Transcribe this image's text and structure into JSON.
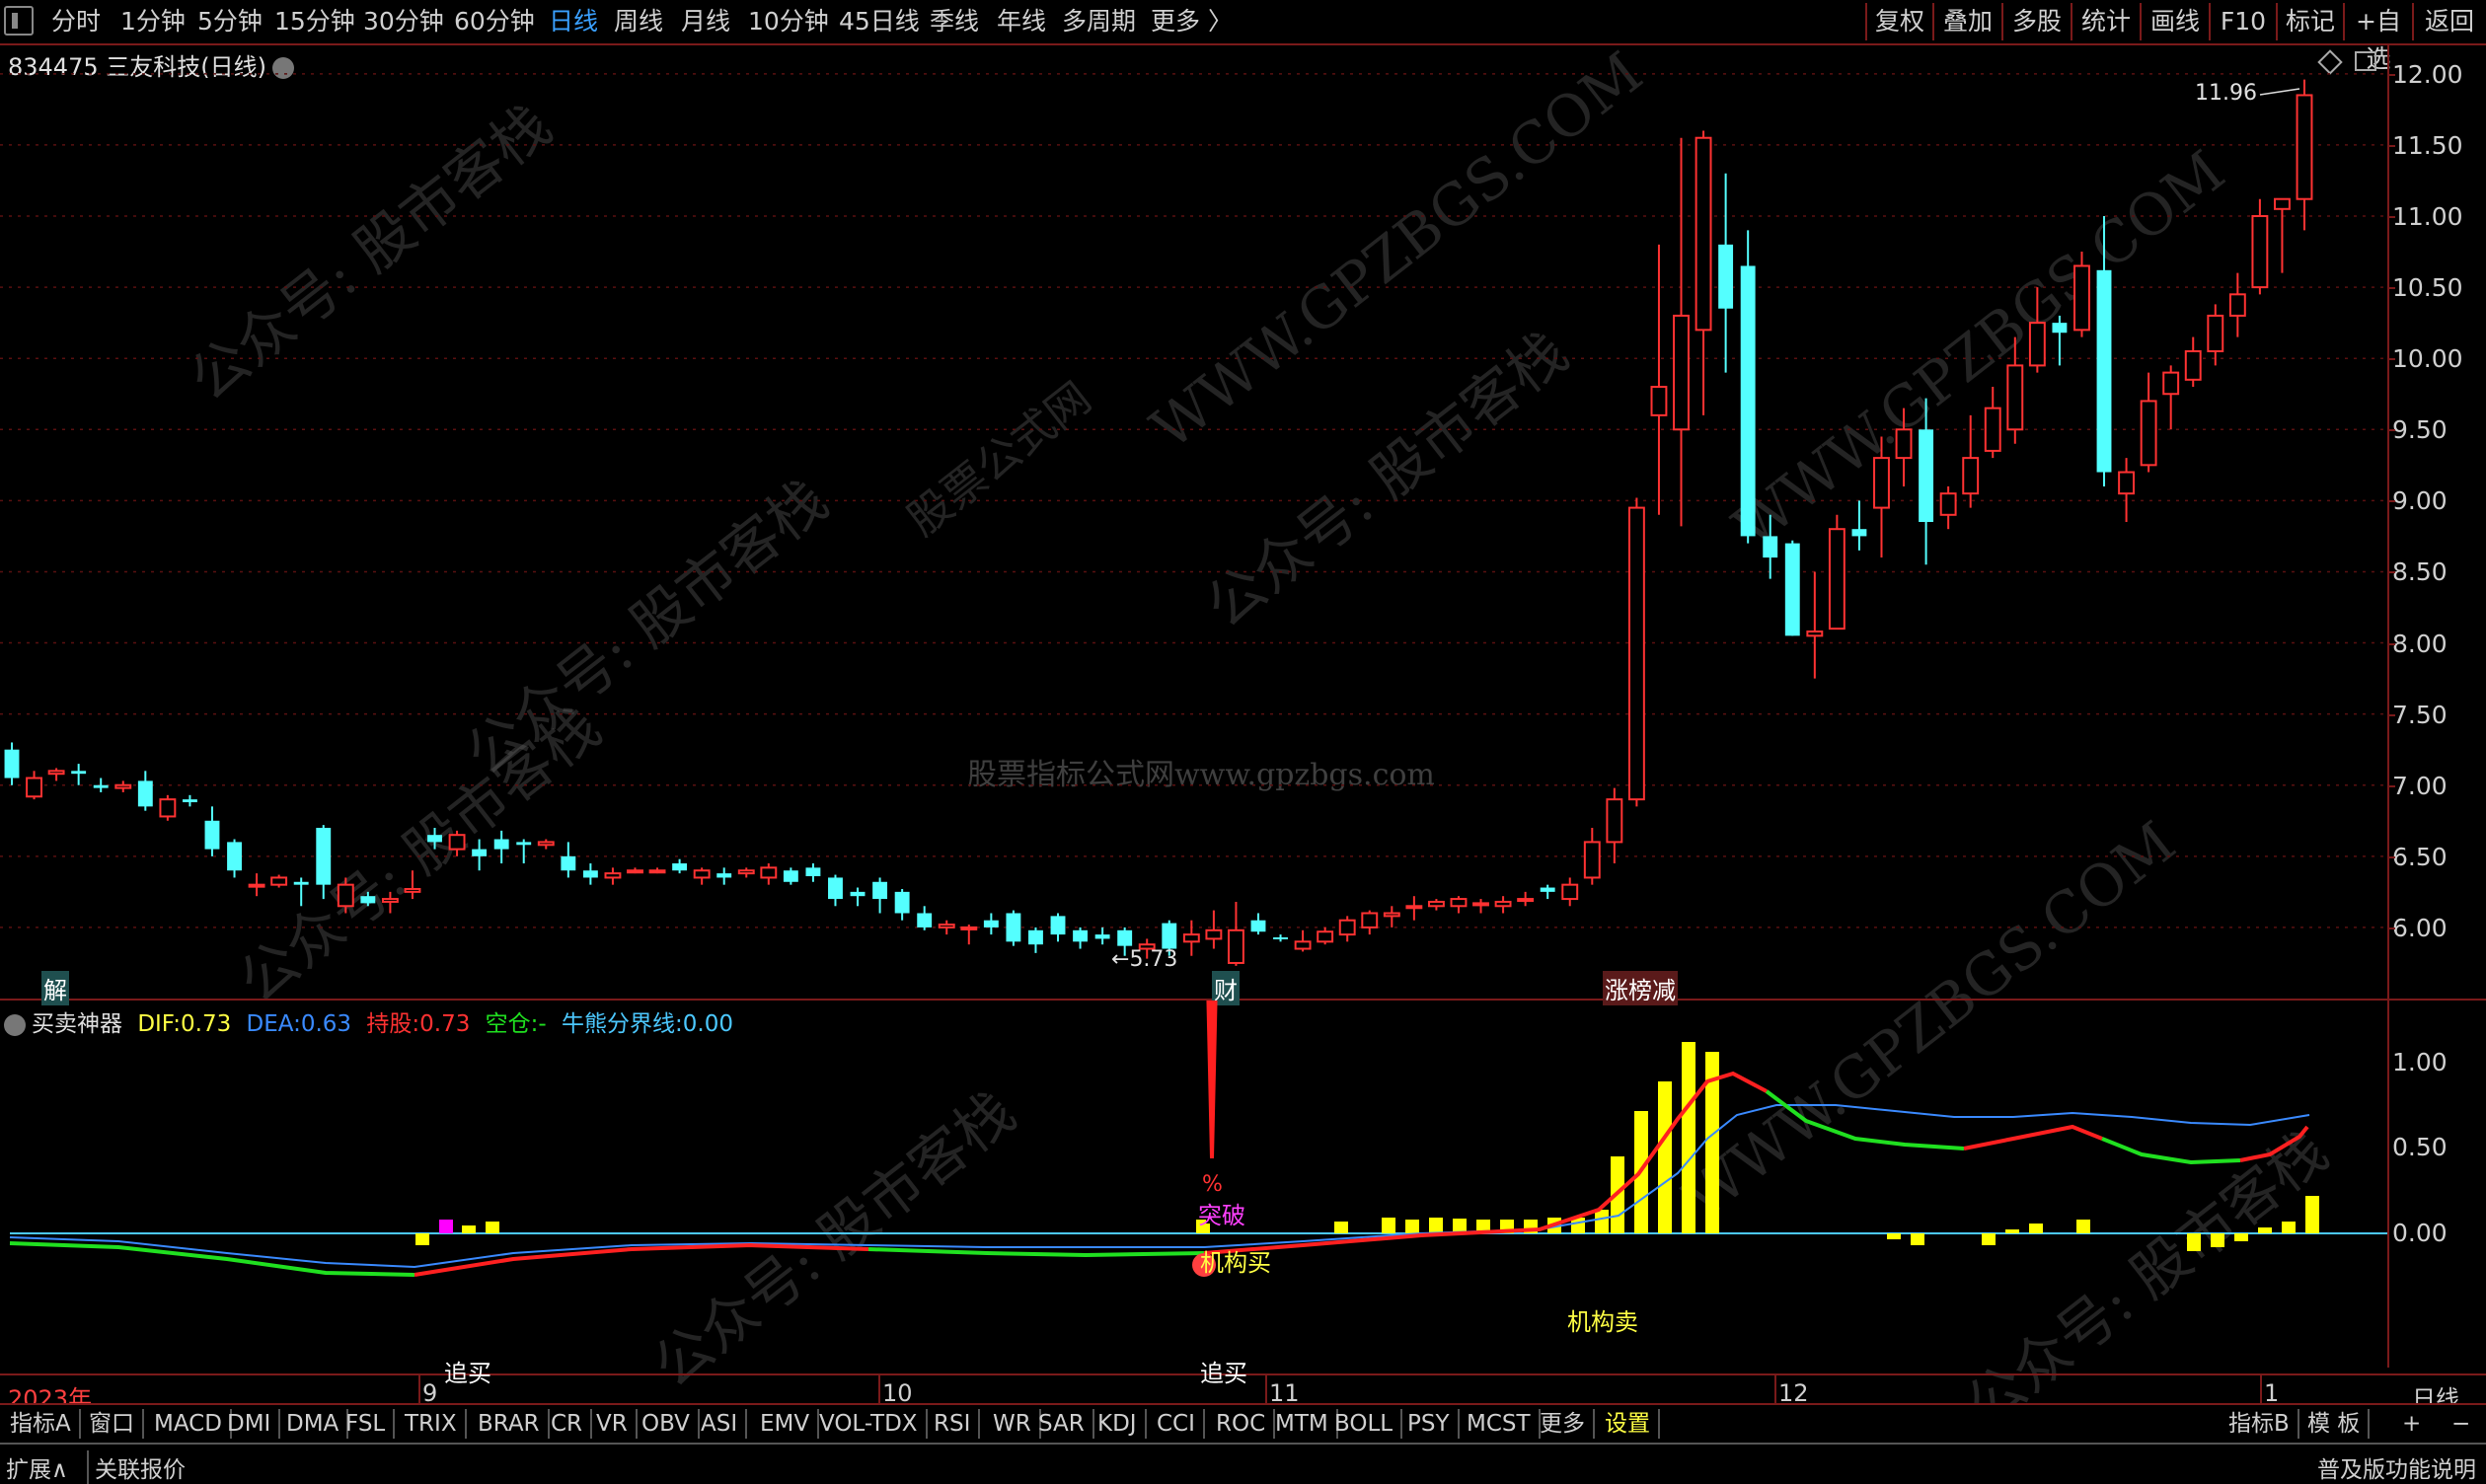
{
  "toolbar": {
    "periods": [
      {
        "label": "分时",
        "active": false
      },
      {
        "label": "1分钟",
        "active": false
      },
      {
        "label": "5分钟",
        "active": false
      },
      {
        "label": "15分钟",
        "active": false
      },
      {
        "label": "30分钟",
        "active": false
      },
      {
        "label": "60分钟",
        "active": false
      },
      {
        "label": "日线",
        "active": true
      },
      {
        "label": "周线",
        "active": false
      },
      {
        "label": "月线",
        "active": false
      },
      {
        "label": "10分钟",
        "active": false
      },
      {
        "label": "45日线",
        "active": false
      },
      {
        "label": "季线",
        "active": false
      },
      {
        "label": "年线",
        "active": false
      },
      {
        "label": "多周期",
        "active": false
      },
      {
        "label": "更多 〉",
        "active": false
      }
    ],
    "right_buttons": [
      "复权",
      "叠加",
      "多股",
      "统计",
      "画线",
      "F10",
      "标记",
      "+自选",
      "返回"
    ]
  },
  "stock_title": "834475 三友科技(日线)",
  "price_axis": [
    "12.00",
    "11.50",
    "11.00",
    "10.50",
    "10.00",
    "9.50",
    "9.00",
    "8.50",
    "8.00",
    "7.50",
    "7.00",
    "6.50",
    "6.00"
  ],
  "annotations": {
    "max_price": "11.96",
    "min_price": "5.73",
    "jie": "解",
    "cai": "财",
    "zhangbang": "涨榜减",
    "zhuimai1": "追买",
    "zhuimai2": "追买",
    "tupo": "突破",
    "pct": "%",
    "jigoumai": "机构买",
    "jigoumai2": "机构卖"
  },
  "indicator": {
    "name": "买卖神器",
    "dif_label": "DIF:",
    "dif": "0.73",
    "dea_label": "DEA:",
    "dea": "0.63",
    "hold_label": "持股:",
    "hold": "0.73",
    "empty_label": "空仓:",
    "empty": "-",
    "bull_label": "牛熊分界线:",
    "bull": "0.00",
    "axis": [
      "1.00",
      "0.50",
      "0.00"
    ]
  },
  "x_axis": [
    "2023年",
    "9",
    "10",
    "11",
    "12",
    "1"
  ],
  "x_right": "日线",
  "tabs": [
    "指标A",
    "窗口",
    "MACD",
    "DMI",
    "DMA",
    "FSL",
    "TRIX",
    "BRAR",
    "CR",
    "VR",
    "OBV",
    "ASI",
    "EMV",
    "VOL-TDX",
    "RSI",
    "WR",
    "SAR",
    "KDJ",
    "CCI",
    "ROC",
    "MTM",
    "BOLL",
    "PSY",
    "MCST",
    "更多",
    "设置"
  ],
  "tabs_right": [
    "指标B",
    "模 板",
    "+",
    "−"
  ],
  "status": {
    "expand": "扩展∧",
    "related": "关联报价",
    "edition": "普及版功能说明"
  },
  "watermarks": [
    "公众号: 股市客栈",
    "WWW.GPZBGS.COM",
    "股票公式网",
    "股票指标公式网www.gpzbgs.com"
  ],
  "colors": {
    "up": "#ff3232",
    "down": "#54ffff",
    "axis_red": "#7a1a1a",
    "yellow": "#ffff00",
    "dif_red": "#ff2020",
    "dif_green": "#20e020",
    "dea_blue": "#3a8aff",
    "cyan_line": "#4cc8ff"
  },
  "chart_data": {
    "type": "candlestick",
    "ylim": [
      5.5,
      12.2
    ],
    "candles": [
      [
        7.25,
        7.05,
        7.3,
        7.0
      ],
      [
        6.92,
        7.05,
        7.1,
        6.9
      ],
      [
        7.08,
        7.1,
        7.12,
        7.03
      ],
      [
        7.1,
        7.08,
        7.15,
        7.0
      ],
      [
        7.0,
        6.98,
        7.05,
        6.95
      ],
      [
        6.98,
        7.0,
        7.03,
        6.95
      ],
      [
        7.03,
        6.85,
        7.1,
        6.82
      ],
      [
        6.78,
        6.9,
        6.93,
        6.75
      ],
      [
        6.9,
        6.88,
        6.93,
        6.85
      ],
      [
        6.75,
        6.55,
        6.85,
        6.5
      ],
      [
        6.6,
        6.4,
        6.62,
        6.35
      ],
      [
        6.3,
        6.3,
        6.38,
        6.22
      ],
      [
        6.3,
        6.35,
        6.37,
        6.28
      ],
      [
        6.32,
        6.3,
        6.35,
        6.15
      ],
      [
        6.7,
        6.3,
        6.72,
        6.2
      ],
      [
        6.15,
        6.3,
        6.35,
        6.1
      ],
      [
        6.22,
        6.17,
        6.25,
        6.15
      ],
      [
        6.18,
        6.2,
        6.25,
        6.1
      ],
      [
        6.25,
        6.27,
        6.4,
        6.2
      ],
      [
        6.65,
        6.6,
        6.7,
        6.55
      ],
      [
        6.55,
        6.65,
        6.68,
        6.5
      ],
      [
        6.55,
        6.5,
        6.62,
        6.4
      ],
      [
        6.62,
        6.55,
        6.68,
        6.45
      ],
      [
        6.6,
        6.58,
        6.62,
        6.45
      ],
      [
        6.58,
        6.6,
        6.62,
        6.55
      ],
      [
        6.5,
        6.4,
        6.6,
        6.35
      ],
      [
        6.4,
        6.35,
        6.45,
        6.3
      ],
      [
        6.35,
        6.38,
        6.42,
        6.3
      ],
      [
        6.4,
        6.4,
        6.42,
        6.38
      ],
      [
        6.4,
        6.4,
        6.42,
        6.38
      ],
      [
        6.45,
        6.4,
        6.48,
        6.38
      ],
      [
        6.35,
        6.4,
        6.42,
        6.3
      ],
      [
        6.38,
        6.35,
        6.42,
        6.3
      ],
      [
        6.38,
        6.4,
        6.42,
        6.35
      ],
      [
        6.35,
        6.42,
        6.45,
        6.3
      ],
      [
        6.4,
        6.32,
        6.42,
        6.3
      ],
      [
        6.42,
        6.36,
        6.45,
        6.32
      ],
      [
        6.35,
        6.2,
        6.37,
        6.15
      ],
      [
        6.25,
        6.22,
        6.28,
        6.15
      ],
      [
        6.32,
        6.2,
        6.35,
        6.1
      ],
      [
        6.25,
        6.1,
        6.27,
        6.05
      ],
      [
        6.1,
        6.0,
        6.15,
        5.98
      ],
      [
        6.0,
        6.02,
        6.05,
        5.95
      ],
      [
        6.0,
        6.0,
        6.02,
        5.88
      ],
      [
        6.05,
        6.0,
        6.1,
        5.95
      ],
      [
        6.1,
        5.9,
        6.12,
        5.87
      ],
      [
        5.98,
        5.88,
        6.0,
        5.82
      ],
      [
        6.08,
        5.95,
        6.1,
        5.9
      ],
      [
        5.98,
        5.9,
        6.0,
        5.85
      ],
      [
        5.95,
        5.92,
        6.0,
        5.88
      ],
      [
        5.98,
        5.87,
        6.0,
        5.8
      ],
      [
        5.85,
        5.88,
        5.92,
        5.78
      ],
      [
        6.03,
        5.85,
        6.05,
        5.8
      ],
      [
        5.9,
        5.95,
        6.05,
        5.8
      ],
      [
        5.92,
        5.98,
        6.12,
        5.85
      ],
      [
        5.75,
        5.98,
        6.18,
        5.73
      ],
      [
        6.05,
        5.97,
        6.1,
        5.95
      ],
      [
        5.93,
        5.92,
        5.95,
        5.9
      ],
      [
        5.85,
        5.9,
        5.98,
        5.83
      ],
      [
        5.9,
        5.97,
        6.0,
        5.88
      ],
      [
        5.95,
        6.05,
        6.08,
        5.9
      ],
      [
        6.0,
        6.1,
        6.12,
        5.95
      ],
      [
        6.08,
        6.1,
        6.15,
        6.0
      ],
      [
        6.15,
        6.15,
        6.22,
        6.05
      ],
      [
        6.15,
        6.18,
        6.2,
        6.12
      ],
      [
        6.15,
        6.2,
        6.22,
        6.1
      ],
      [
        6.17,
        6.17,
        6.2,
        6.1
      ],
      [
        6.15,
        6.18,
        6.22,
        6.1
      ],
      [
        6.2,
        6.2,
        6.25,
        6.15
      ],
      [
        6.28,
        6.25,
        6.3,
        6.2
      ],
      [
        6.2,
        6.3,
        6.35,
        6.15
      ],
      [
        6.35,
        6.6,
        6.7,
        6.3
      ],
      [
        6.6,
        6.9,
        6.98,
        6.45
      ],
      [
        6.9,
        8.95,
        9.02,
        6.85
      ],
      [
        9.6,
        9.8,
        10.8,
        8.9
      ],
      [
        9.5,
        10.3,
        11.55,
        8.82
      ],
      [
        10.2,
        11.55,
        11.6,
        9.6
      ],
      [
        10.8,
        10.35,
        11.3,
        9.9
      ],
      [
        10.65,
        8.75,
        10.9,
        8.7
      ],
      [
        8.75,
        8.6,
        8.9,
        8.45
      ],
      [
        8.7,
        8.05,
        8.72,
        8.05
      ],
      [
        8.05,
        8.08,
        8.5,
        7.75
      ],
      [
        8.1,
        8.8,
        8.9,
        8.1
      ],
      [
        8.8,
        8.75,
        9.0,
        8.65
      ],
      [
        8.95,
        9.3,
        9.45,
        8.6
      ],
      [
        9.3,
        9.5,
        9.65,
        9.1
      ],
      [
        9.5,
        8.85,
        9.72,
        8.55
      ],
      [
        8.9,
        9.05,
        9.1,
        8.8
      ],
      [
        9.05,
        9.3,
        9.6,
        8.95
      ],
      [
        9.35,
        9.65,
        9.8,
        9.3
      ],
      [
        9.5,
        9.95,
        10.15,
        9.4
      ],
      [
        9.95,
        10.25,
        10.5,
        9.9
      ],
      [
        10.25,
        10.18,
        10.3,
        9.95
      ],
      [
        10.2,
        10.65,
        10.75,
        10.15
      ],
      [
        10.62,
        9.2,
        11.0,
        9.1
      ],
      [
        9.05,
        9.2,
        9.3,
        8.85
      ],
      [
        9.25,
        9.7,
        9.9,
        9.2
      ],
      [
        9.75,
        9.9,
        9.95,
        9.5
      ],
      [
        9.85,
        10.05,
        10.15,
        9.8
      ],
      [
        10.05,
        10.3,
        10.38,
        9.95
      ],
      [
        10.3,
        10.45,
        10.6,
        10.15
      ],
      [
        10.5,
        11.0,
        11.12,
        10.45
      ],
      [
        11.05,
        11.12,
        11.12,
        10.6
      ],
      [
        11.12,
        11.85,
        11.96,
        10.9
      ]
    ]
  }
}
